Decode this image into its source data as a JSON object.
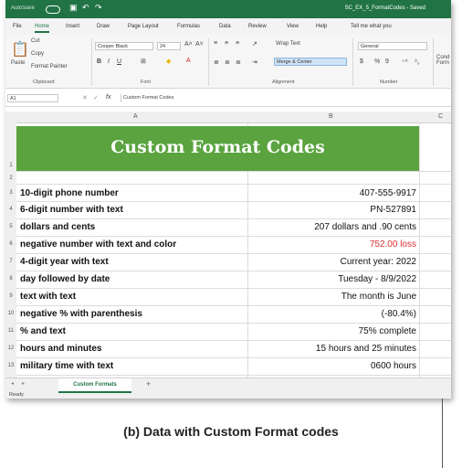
{
  "titlebar": {
    "autosave": "AutoSave",
    "toggle": "Off",
    "title": "SC_EX_5_FormatCodes - Saved"
  },
  "tabs": [
    "File",
    "Home",
    "Insert",
    "Draw",
    "Page Layout",
    "Formulas",
    "Data",
    "Review",
    "View",
    "Help",
    "Tell me what you"
  ],
  "ribbon": {
    "clipboard": {
      "paste": "Paste",
      "cut": "Cut",
      "copy": "Copy",
      "format_painter": "Format Painter",
      "label": "Clipboard"
    },
    "font": {
      "name": "Cooper Black",
      "size": "24",
      "label": "Font"
    },
    "alignment": {
      "wrap_text": "Wrap Text",
      "merge_center": "Merge & Center",
      "label": "Alignment"
    },
    "number": {
      "format": "General",
      "currency": "$",
      "percent": "%",
      "comma": "9",
      "label": "Number"
    },
    "styles": {
      "conditional": "Cond Form"
    }
  },
  "formula_bar": {
    "name_box": "A1",
    "fx": "fx",
    "content": "Custom Format Codes"
  },
  "columns": [
    "A",
    "B",
    "C"
  ],
  "sheet": {
    "banner": "Custom Format Codes",
    "rows": [
      {
        "num": "1",
        "a": "",
        "b": ""
      },
      {
        "num": "2",
        "a": "",
        "b": ""
      },
      {
        "num": "3",
        "a": "10-digit phone number",
        "b": "407-555-9917"
      },
      {
        "num": "4",
        "a": "6-digit number with text",
        "b": "PN-527891"
      },
      {
        "num": "5",
        "a": "dollars and cents",
        "b": "207 dollars and .90 cents"
      },
      {
        "num": "6",
        "a": "negative number with text and color",
        "b": "752.00 loss"
      },
      {
        "num": "7",
        "a": "4-digit year with text",
        "b": "Current year: 2022"
      },
      {
        "num": "8",
        "a": "day followed by date",
        "b": "Tuesday - 8/9/2022"
      },
      {
        "num": "9",
        "a": "text with text",
        "b": "The month is June"
      },
      {
        "num": "10",
        "a": "negative % with parenthesis",
        "b": "(-80.4%)"
      },
      {
        "num": "11",
        "a": "% and text",
        "b": "75%  complete"
      },
      {
        "num": "12",
        "a": "hours and minutes",
        "b": "15 hours and 25 minutes"
      },
      {
        "num": "13",
        "a": "military time with text",
        "b": "0600 hours"
      }
    ]
  },
  "sheet_tab": "Custom Formats",
  "add_sheet": "+",
  "status": "Ready",
  "caption": "(b) Data with Custom Format codes",
  "colors": {
    "excel_green": "#217346",
    "banner_green": "#5aa33f",
    "loss_red": "#e03030"
  }
}
